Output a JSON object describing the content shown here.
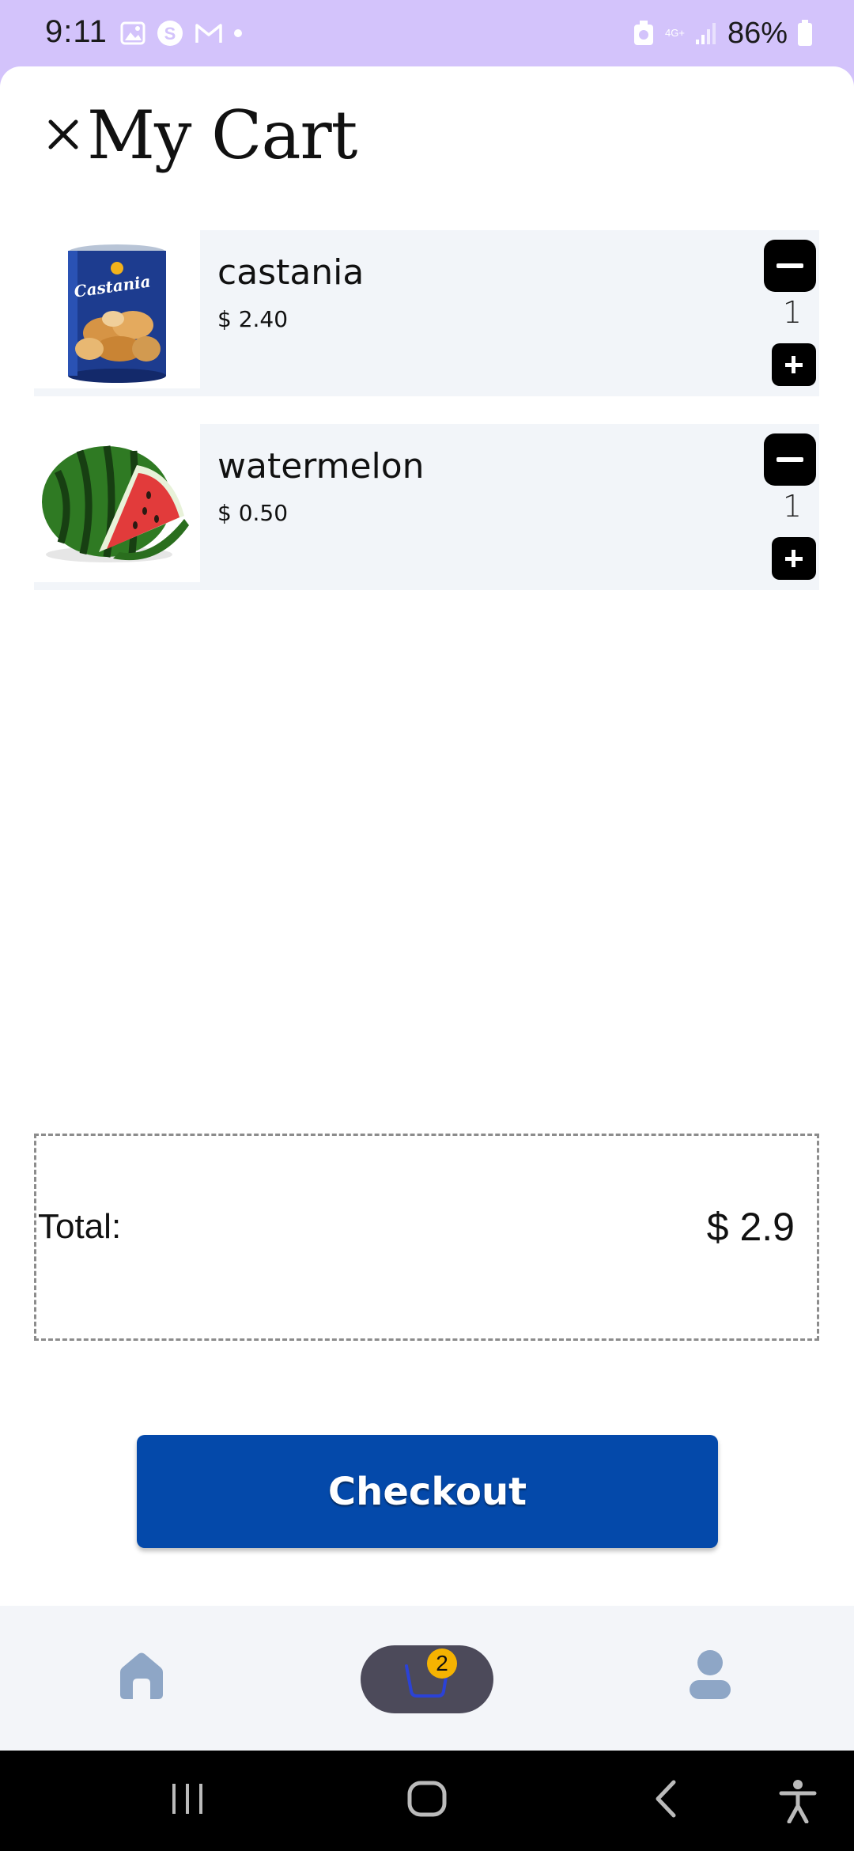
{
  "status_bar": {
    "time": "9:11",
    "network": "4G+",
    "battery": "86%"
  },
  "header": {
    "title": "My Cart",
    "close_icon": "close-icon"
  },
  "cart": {
    "items": [
      {
        "name": "castania",
        "price": "$ 2.40",
        "quantity": "1",
        "image_icon": "nut-can-product-image"
      },
      {
        "name": "watermelon",
        "price": "$ 0.50",
        "quantity": "1",
        "image_icon": "watermelon-product-image"
      }
    ]
  },
  "summary": {
    "total_label": "Total:",
    "total_value": "$ 2.9"
  },
  "checkout": {
    "label": "Checkout",
    "color": "#0449aa"
  },
  "tabbar": {
    "items": [
      {
        "name": "home",
        "icon": "home-icon"
      },
      {
        "name": "cart",
        "icon": "cart-icon",
        "badge": "2"
      },
      {
        "name": "profile",
        "icon": "user-icon"
      }
    ]
  },
  "colors": {
    "status_bar": "#d3c3fb",
    "item_background": "#f2f5f9",
    "badge": "#f5b301",
    "active_tab": "#4c4a5a"
  }
}
